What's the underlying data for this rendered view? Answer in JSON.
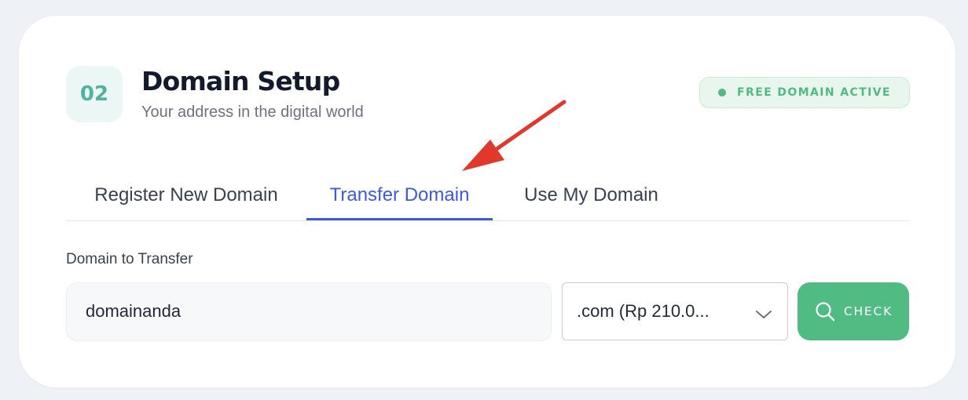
{
  "section": {
    "step_number": "02",
    "title": "Domain Setup",
    "subtitle": "Your address in the digital world",
    "status_badge": "FREE DOMAIN ACTIVE"
  },
  "tabs": [
    {
      "label": "Register New Domain",
      "active": false
    },
    {
      "label": "Transfer Domain",
      "active": true
    },
    {
      "label": "Use My Domain",
      "active": false
    }
  ],
  "form": {
    "field_label": "Domain to Transfer",
    "domain_value": "domainanda",
    "tld_selected": ".com (Rp 210.0...",
    "check_label": "CHECK"
  },
  "icons": {
    "search": "search-icon",
    "chevron": "chevron-down-icon",
    "status": "status-dot-icon",
    "annotation": "red-arrow-annotation"
  },
  "colors": {
    "accent_blue": "#3b5bdb",
    "accent_green": "#50bb83",
    "badge_teal": "#4fb39e",
    "annotation_red": "#e0392b"
  }
}
